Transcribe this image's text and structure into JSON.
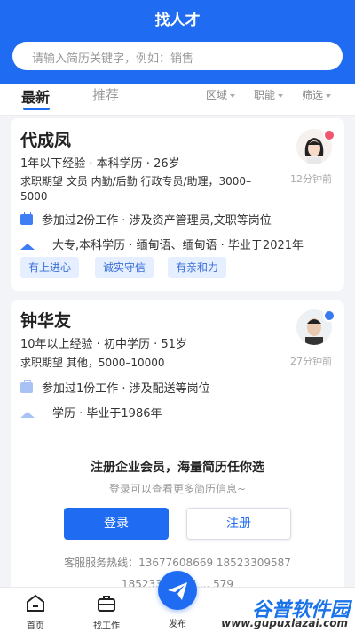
{
  "header": {
    "title": "找人才"
  },
  "search": {
    "placeholder": "请输入简历关键字，例如：销售"
  },
  "tabs": {
    "latest": "最新",
    "recommended": "推荐"
  },
  "filters": {
    "area": "区域",
    "function": "职能",
    "filter": "筛选"
  },
  "resumes": [
    {
      "name": "代成凤",
      "meta": "1年以下经验 · 本科学历 · 26岁",
      "expect": "求职期望 文员 内勤/后勤 行政专员/助理，3000–5000",
      "time": "12分钟前",
      "work": "参加过2份工作 · 涉及资产管理员,文职等岗位",
      "edu": "大专,本科学历 · 缅甸语、缅甸语 · 毕业于2021年",
      "tags": [
        "有上进心",
        "诚实守信",
        "有亲和力"
      ],
      "badge_color": "#f0566e"
    },
    {
      "name": "钟华友",
      "meta": "10年以上经验 · 初中学历 · 51岁",
      "expect": "求职期望 其他，5000–10000",
      "time": "27分钟前",
      "work": "参加过1份工作 · 涉及配送等岗位",
      "edu": "学历 · 毕业于1986年",
      "badge_color": "#3a7af0"
    }
  ],
  "promo": {
    "title": "注册企业会员，海量简历任你选",
    "subtitle": "登录可以查看更多简历信息~",
    "login": "登录",
    "register": "注册",
    "hotline": "客服服务热线：13677608669 18523309587",
    "hotline2": "18523309587 ... 579"
  },
  "nav": {
    "home": "首页",
    "jobs": "找工作",
    "publish": "发布"
  },
  "watermark": {
    "brand": "谷普软件园",
    "url": "www.gupuxlazai.com"
  },
  "colors": {
    "primary": "#1f6bf2"
  }
}
